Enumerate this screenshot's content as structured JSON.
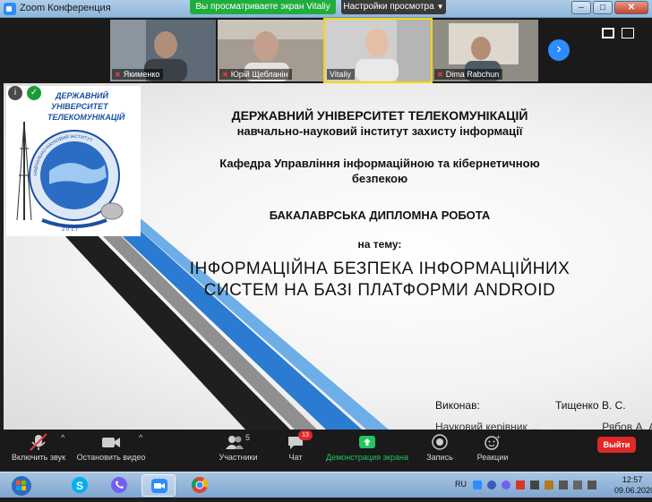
{
  "window": {
    "title": "Zoom Конференция",
    "share_banner": "Вы просматриваете экран Vitaliy",
    "view_settings": "Настройки просмотра",
    "buttons": {
      "minimize": "–",
      "maximize": "□",
      "close": "✕"
    }
  },
  "participants_strip": {
    "tiles": [
      {
        "name": "Якименко",
        "muted": true
      },
      {
        "name": "Юрій Щебланін",
        "muted": true
      },
      {
        "name": "Vitaliy",
        "muted": false
      },
      {
        "name": "Dima Rabchun",
        "muted": true
      }
    ],
    "next_arrow": "›"
  },
  "slide": {
    "university": "ДЕРЖАВНИЙ УНІВЕРСИТЕТ ТЕЛЕКОМУНІКАЦІЙ",
    "institute": "навчально-науковий  інститут захисту інформації",
    "department_line1": "Кафедра Управління інформаційною та кібернетичною",
    "department_line2": "безпекою",
    "work_type": "БАКАЛАВРСЬКА ДИПЛОМНА РОБОТА",
    "on_topic": "на тему:",
    "topic_line1": "ІНФОРМАЦІЙНА БЕЗПЕКА ІНФОРМАЦІЙНИХ",
    "topic_line2": "СИСТЕМ НА БАЗІ ПЛАТФОРМИ ANDROID",
    "author_label": "Виконав:",
    "author_name": "Тищенко В. С.",
    "supervisor_partial": "Науковий керівник ...                     Рябов А. А.",
    "logo": {
      "line1": "ДЕРЖАВНИЙ",
      "line2": "УНІВЕРСИТЕТ",
      "line3": "ТЕЛЕКОМУНІКАЦІЙ",
      "ribbon": "НАВЧАЛЬНО-НАУКОВИЙ ІНСТИТУТ",
      "bottom": "2 0 1 7"
    }
  },
  "toolbar": {
    "mute": "Включить звук",
    "video": "Остановить видео",
    "participants": "Участники",
    "participants_count": "5",
    "chat": "Чат",
    "chat_badge": "13",
    "share": "Демонстрация экрана",
    "record": "Запись",
    "reactions": "Реакции",
    "leave": "Выйти"
  },
  "taskbar": {
    "language": "RU",
    "time": "12:57",
    "date": "09.06.2020"
  },
  "colors": {
    "zoom_blue": "#2d8cff",
    "share_green": "#1fae3d",
    "leave_red": "#e02828"
  }
}
